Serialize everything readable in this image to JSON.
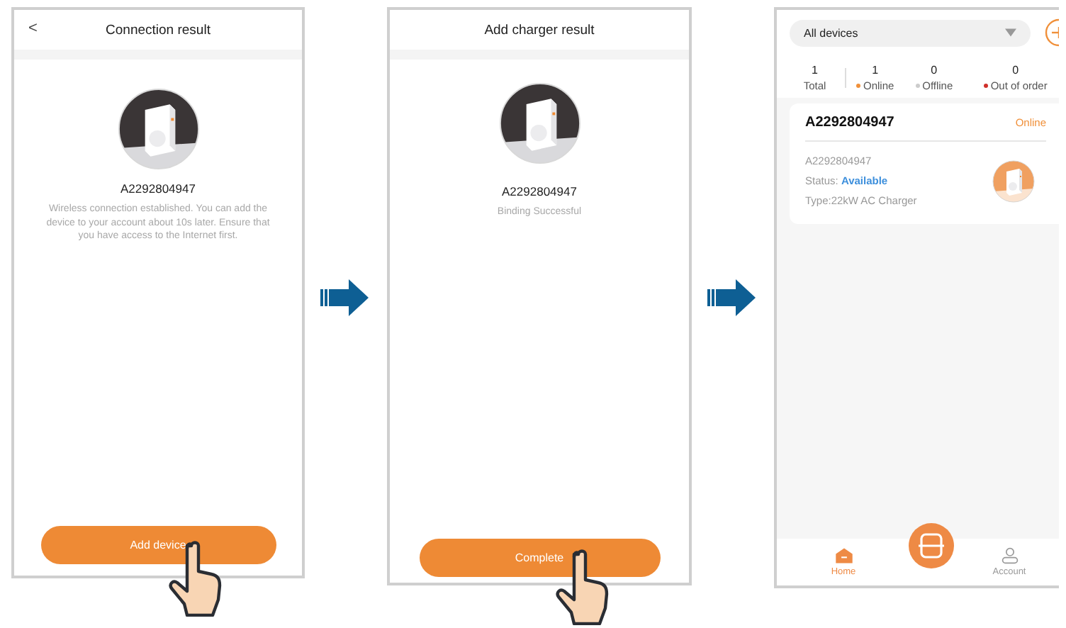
{
  "screens": [
    {
      "title": "Connection result",
      "back_button": "<",
      "serial": "A2292804947",
      "message": "Wireless connection established. You can add the device to your account about 10s later. Ensure that you have access to the Internet first.",
      "button": "Add device"
    },
    {
      "title": "Add charger result",
      "serial": "A2292804947",
      "message": "Binding Successful",
      "button": "Complete"
    }
  ],
  "device_list": {
    "filter": "All devices",
    "stats": [
      {
        "value": "1",
        "label": "Total"
      },
      {
        "value": "1",
        "label": "Online",
        "color": "#f0903a"
      },
      {
        "value": "0",
        "label": "Offline",
        "color": "#cccccc"
      },
      {
        "value": "0",
        "label": "Out of order",
        "color": "#d0302a"
      }
    ],
    "devices": [
      {
        "name": "A2292804947",
        "status": "Online",
        "serial": "A2292804947",
        "status_label": "Status:",
        "status_value": "Available",
        "type": "Type:22kW AC Charger"
      }
    ],
    "nav": [
      {
        "label": "Home",
        "selected": true
      },
      {
        "label": "Account",
        "selected": false
      }
    ]
  }
}
